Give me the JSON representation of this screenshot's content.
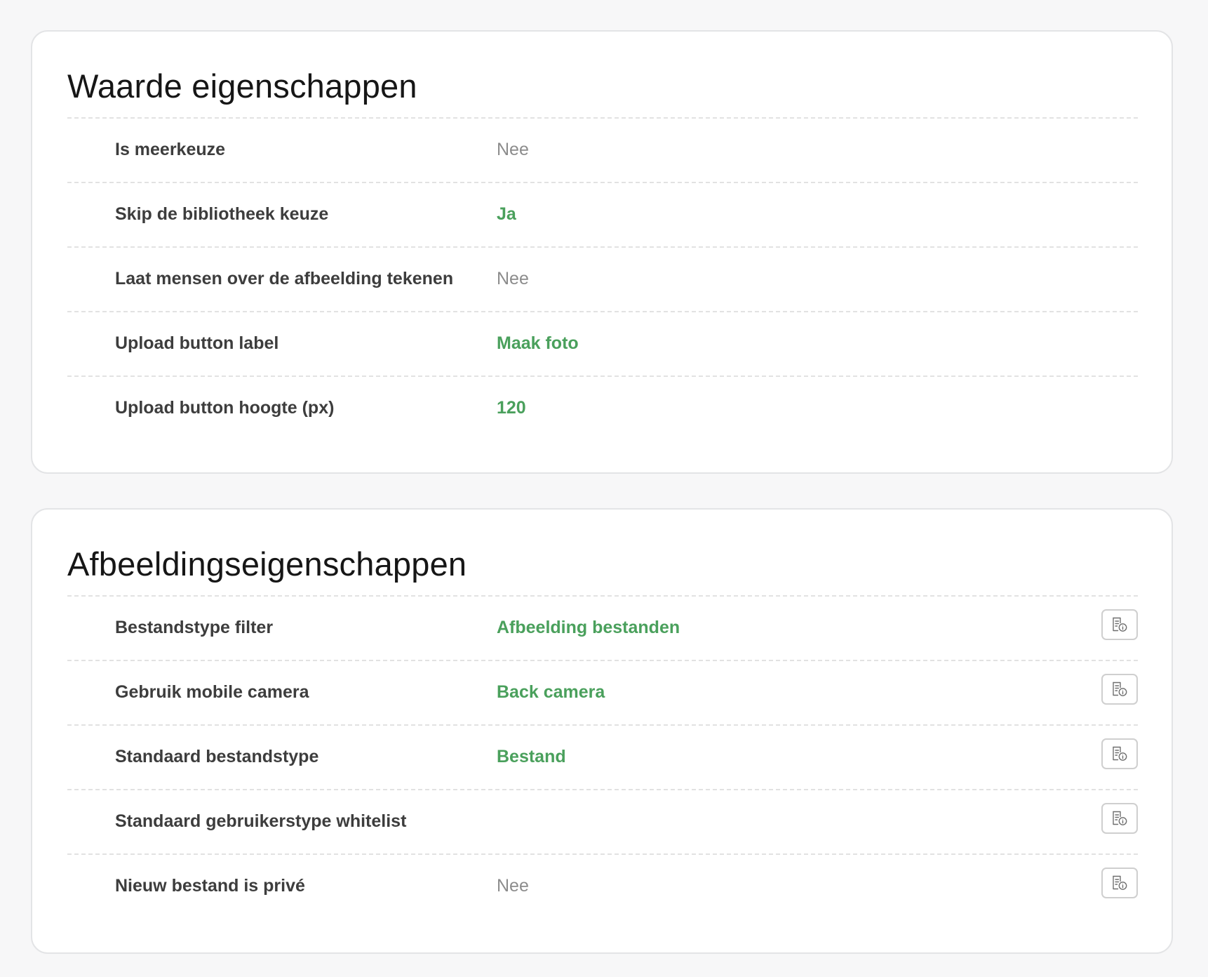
{
  "waarde": {
    "title": "Waarde eigenschappen",
    "rows": [
      {
        "label": "Is meerkeuze",
        "value": "Nee"
      },
      {
        "label": "Skip de bibliotheek keuze",
        "value": "Ja"
      },
      {
        "label": "Laat mensen over de afbeelding tekenen",
        "value": "Nee"
      },
      {
        "label": "Upload button label",
        "value": "Maak foto"
      },
      {
        "label": "Upload button hoogte (px)",
        "value": "120"
      }
    ]
  },
  "afbeelding": {
    "title": "Afbeeldingseigenschappen",
    "rows": [
      {
        "label": "Bestandstype filter",
        "value": "Afbeelding bestanden"
      },
      {
        "label": "Gebruik mobile camera",
        "value": "Back camera"
      },
      {
        "label": "Standaard bestandstype",
        "value": "Bestand"
      },
      {
        "label": "Standaard gebruikerstype whitelist",
        "value": ""
      },
      {
        "label": "Nieuw bestand is privé",
        "value": "Nee"
      }
    ],
    "row_action_icon": "document-info-icon"
  },
  "colors": {
    "set_value": "#4aa05c",
    "no_value": "#8c8c8c",
    "label": "#3d3d3d",
    "title": "#161616",
    "card_border": "#e3e4e6",
    "background": "#f7f7f8"
  }
}
